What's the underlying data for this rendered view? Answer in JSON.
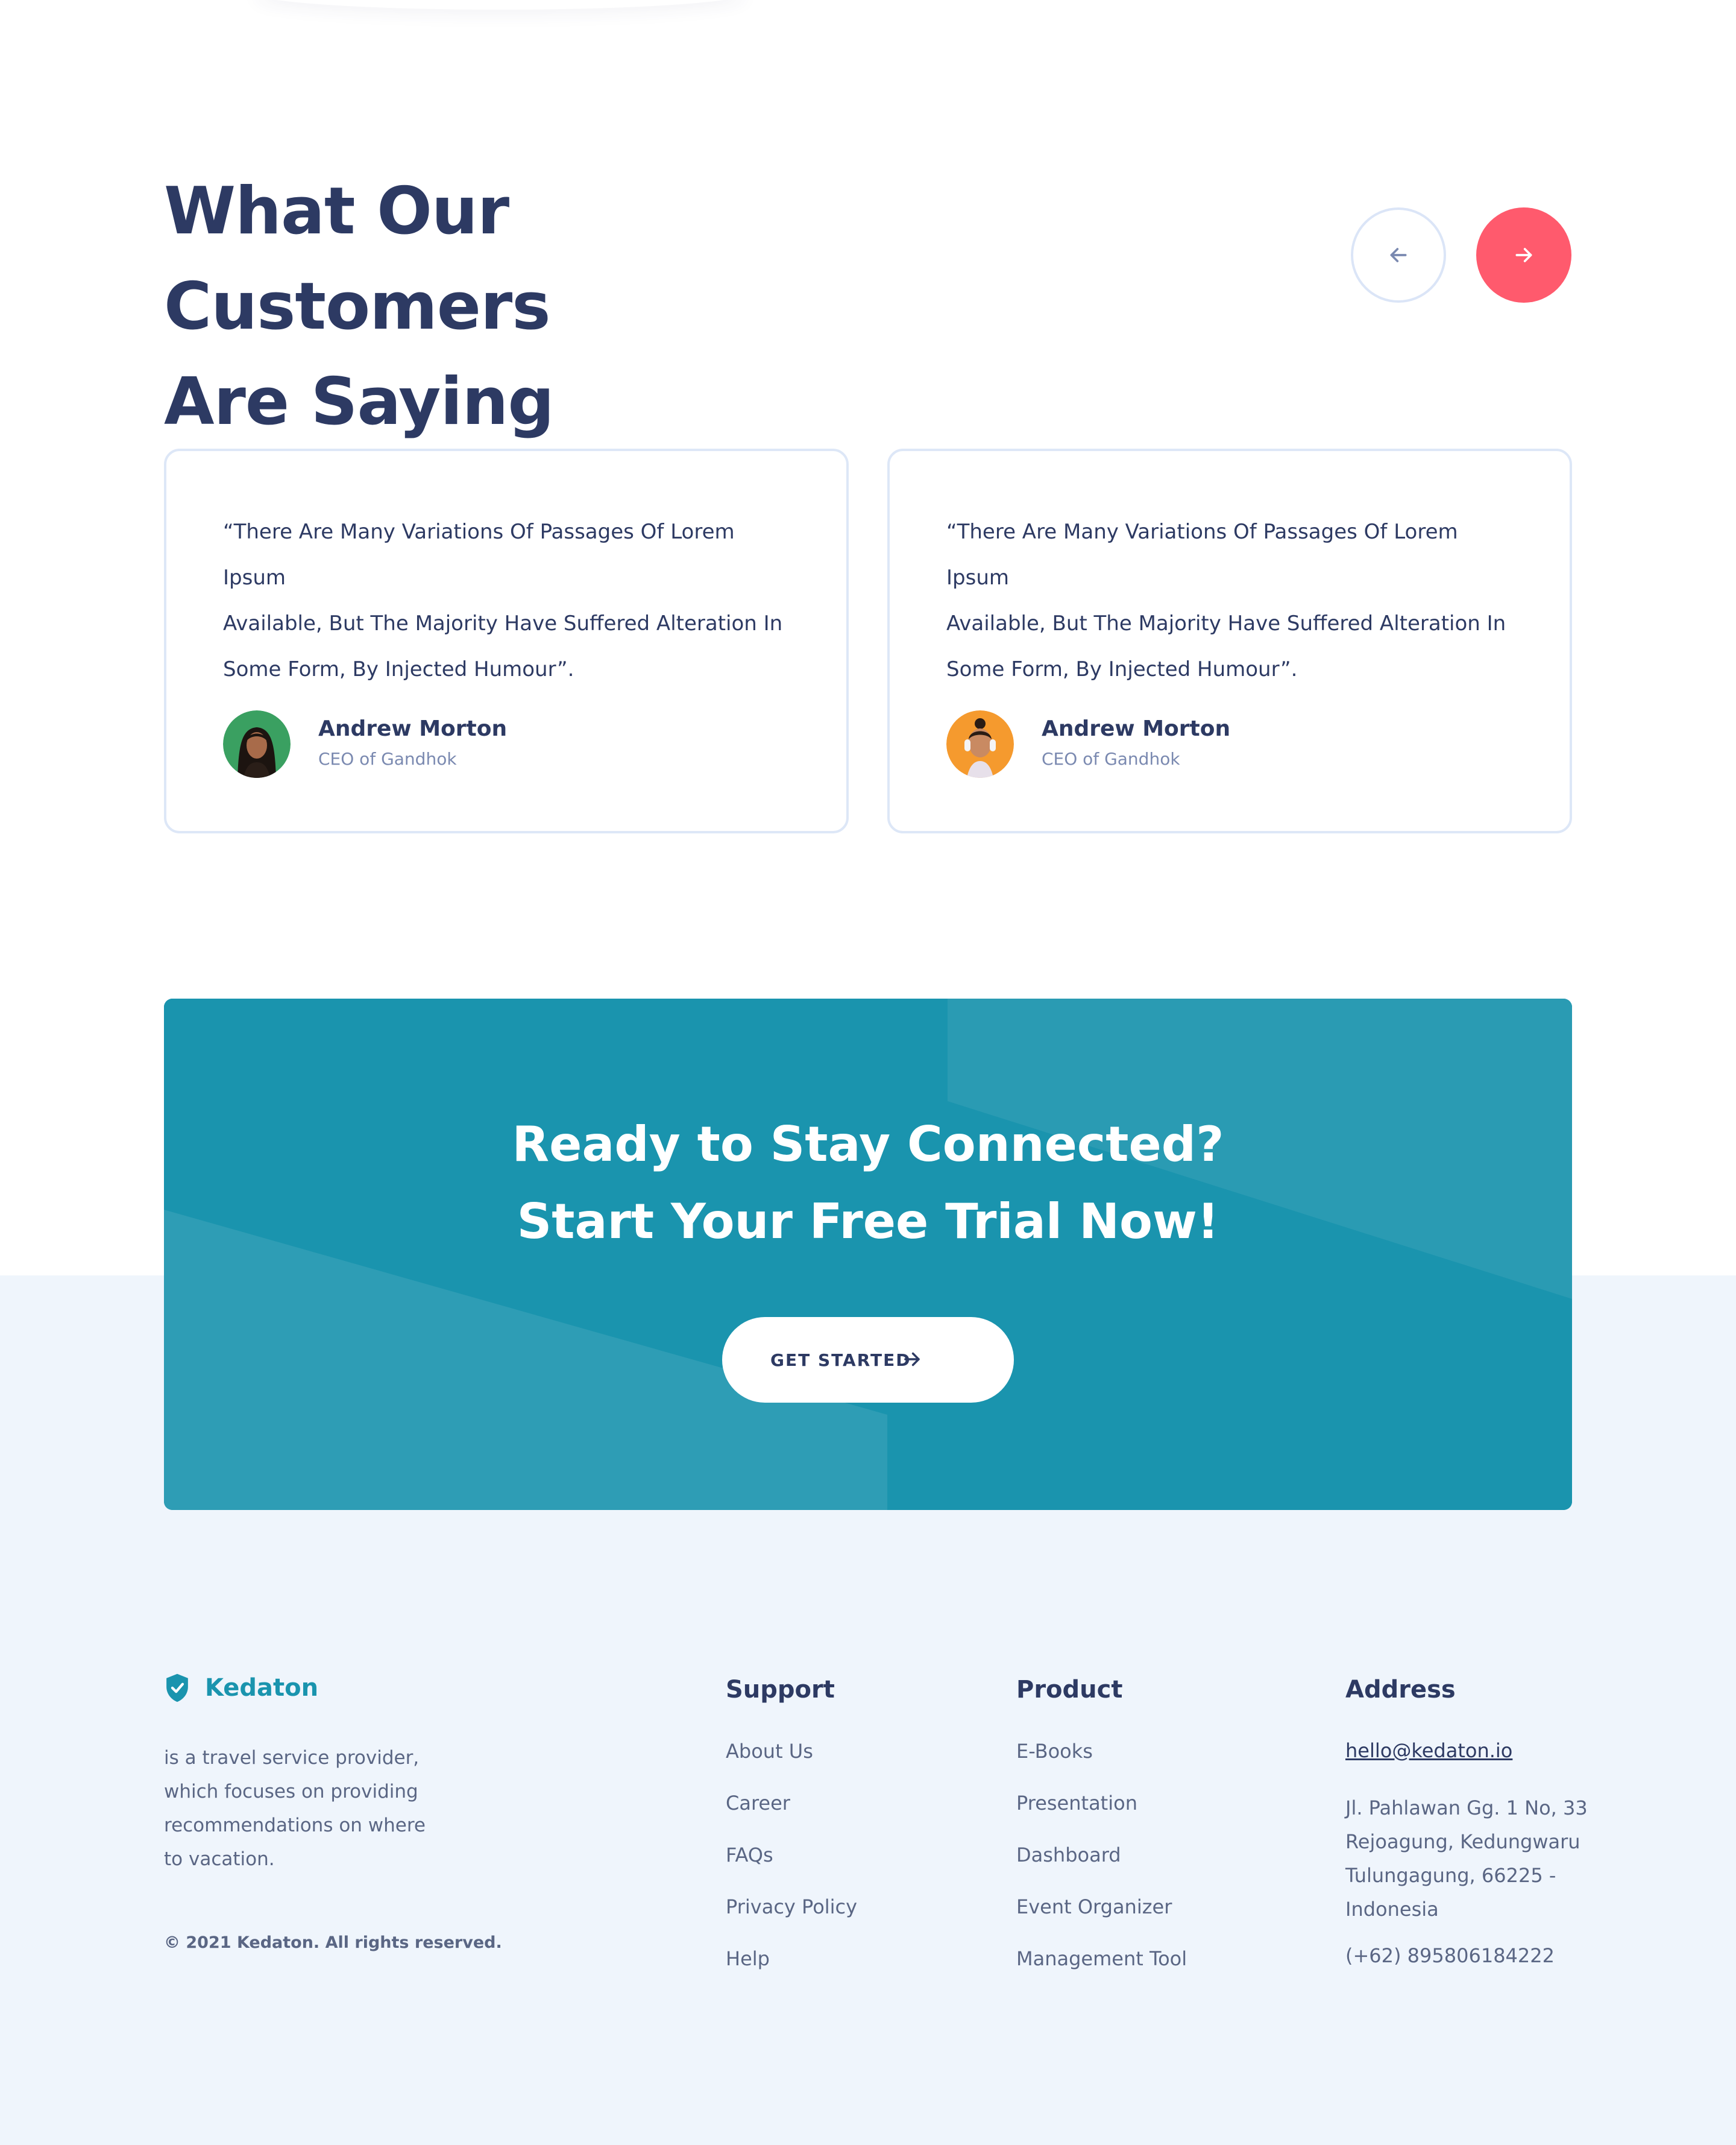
{
  "testimonials": {
    "title_line1": "What Our Customers",
    "title_line2": "Are Saying",
    "prev_icon": "arrow-left-icon",
    "next_icon": "arrow-right-icon",
    "cards": [
      {
        "quote_line1": "“There Are Many Variations Of Passages Of Lorem Ipsum",
        "quote_line2": "Available, But The Majority Have Suffered Alteration In",
        "quote_line3": "Some Form, By Injected Humour”.",
        "name": "Andrew Morton",
        "role": "CEO of Gandhok",
        "avatar_bg": "#3aa061"
      },
      {
        "quote_line1": "“There Are Many Variations Of Passages Of Lorem Ipsum",
        "quote_line2": "Available, But The Majority Have Suffered Alteration In",
        "quote_line3": "Some Form, By Injected Humour”.",
        "name": "Andrew Morton",
        "role": "CEO of Gandhok",
        "avatar_bg": "#f59a2e"
      }
    ]
  },
  "cta": {
    "title_line1": "Ready to Stay Connected?",
    "title_line2": "Start Your Free Trial Now!",
    "button_label": "GET STARTED",
    "button_icon": "arrow-right-icon"
  },
  "footer": {
    "brand_name": "Kedaton",
    "brand_icon": "shield-check-icon",
    "about_line1": "is a travel service provider,",
    "about_line2": "which focuses on providing",
    "about_line3": "recommendations on where",
    "about_line4": "to vacation.",
    "copyright": "© 2021 Kedaton. All rights reserved.",
    "support": {
      "title": "Support",
      "links": [
        "About Us",
        "Career",
        "FAQs",
        "Privacy Policy",
        "Help"
      ]
    },
    "product": {
      "title": "Product",
      "links": [
        "E-Books",
        "Presentation",
        "Dashboard",
        "Event Organizer",
        "Management Tool"
      ]
    },
    "address": {
      "title": "Address",
      "email": "hello@kedaton.io",
      "line1": "Jl. Pahlawan Gg. 1 No, 33",
      "line2": "Rejoagung, Kedungwaru",
      "line3": "Tulungagung, 66225 -",
      "line4": "Indonesia",
      "phone": "(+62) 895806184222"
    }
  },
  "colors": {
    "heading": "#2d3a63",
    "accent_red": "#ff5a6d",
    "teal": "#1a94ae",
    "footer_bg": "#eff5fc"
  }
}
